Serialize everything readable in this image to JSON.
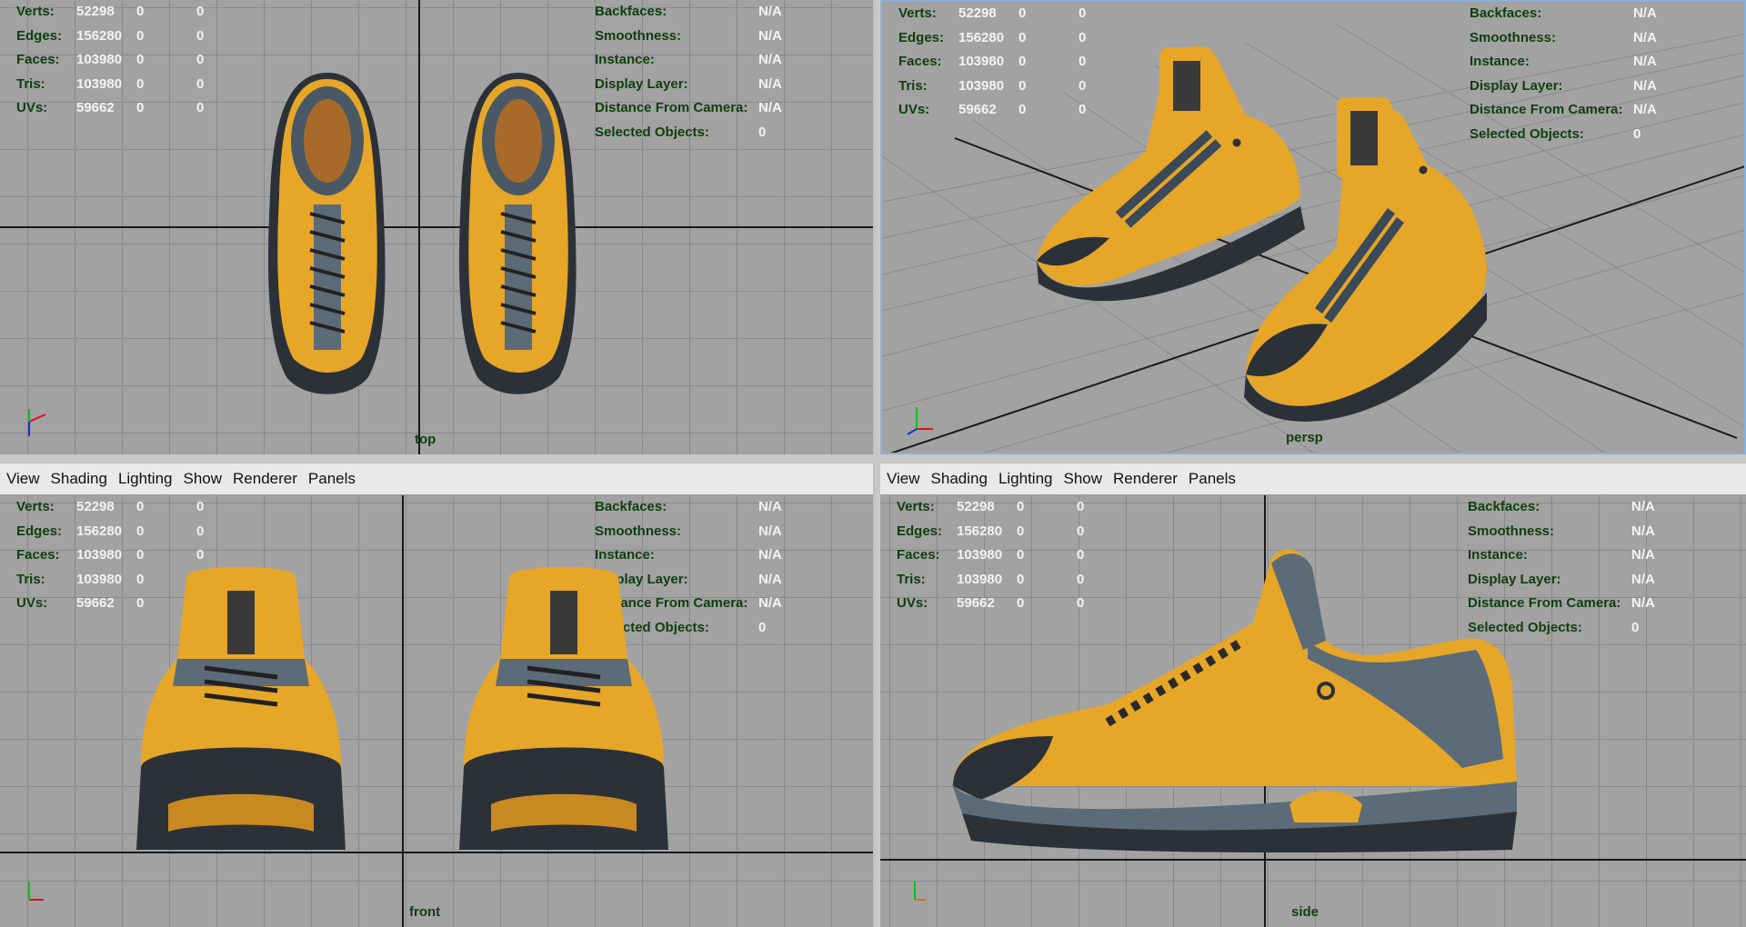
{
  "menu": [
    "View",
    "Shading",
    "Lighting",
    "Show",
    "Renderer",
    "Panels"
  ],
  "hud_labels": {
    "verts": "Verts:",
    "edges": "Edges:",
    "faces": "Faces:",
    "tris": "Tris:",
    "uvs": "UVs:",
    "backfaces": "Backfaces:",
    "smoothness": "Smoothness:",
    "instance": "Instance:",
    "display_layer": "Display Layer:",
    "distance": "Distance From Camera:",
    "selected": "Selected Objects:"
  },
  "hud_values": {
    "verts": "52298",
    "edges": "156280",
    "faces": "103980",
    "tris": "103980",
    "uvs": "59662",
    "zero": "0",
    "na": "N/A",
    "selected": "0"
  },
  "viewports": {
    "top": "top",
    "persp": "persp",
    "front": "front",
    "side": "side"
  },
  "axis": {
    "x": "x",
    "y": "y",
    "z": "z"
  },
  "colors": {
    "viewport_bg": "#a2a2a2",
    "grid": "#8a8a8a",
    "hud_label": "#0e3f0e",
    "hud_value": "#f3f3f3",
    "shoe_yellow": "#e6a628",
    "shoe_dark": "#2c3138",
    "shoe_blue": "#5b6b78",
    "axis_x": "#e01010",
    "axis_y": "#10c010",
    "axis_z": "#1030e0"
  }
}
